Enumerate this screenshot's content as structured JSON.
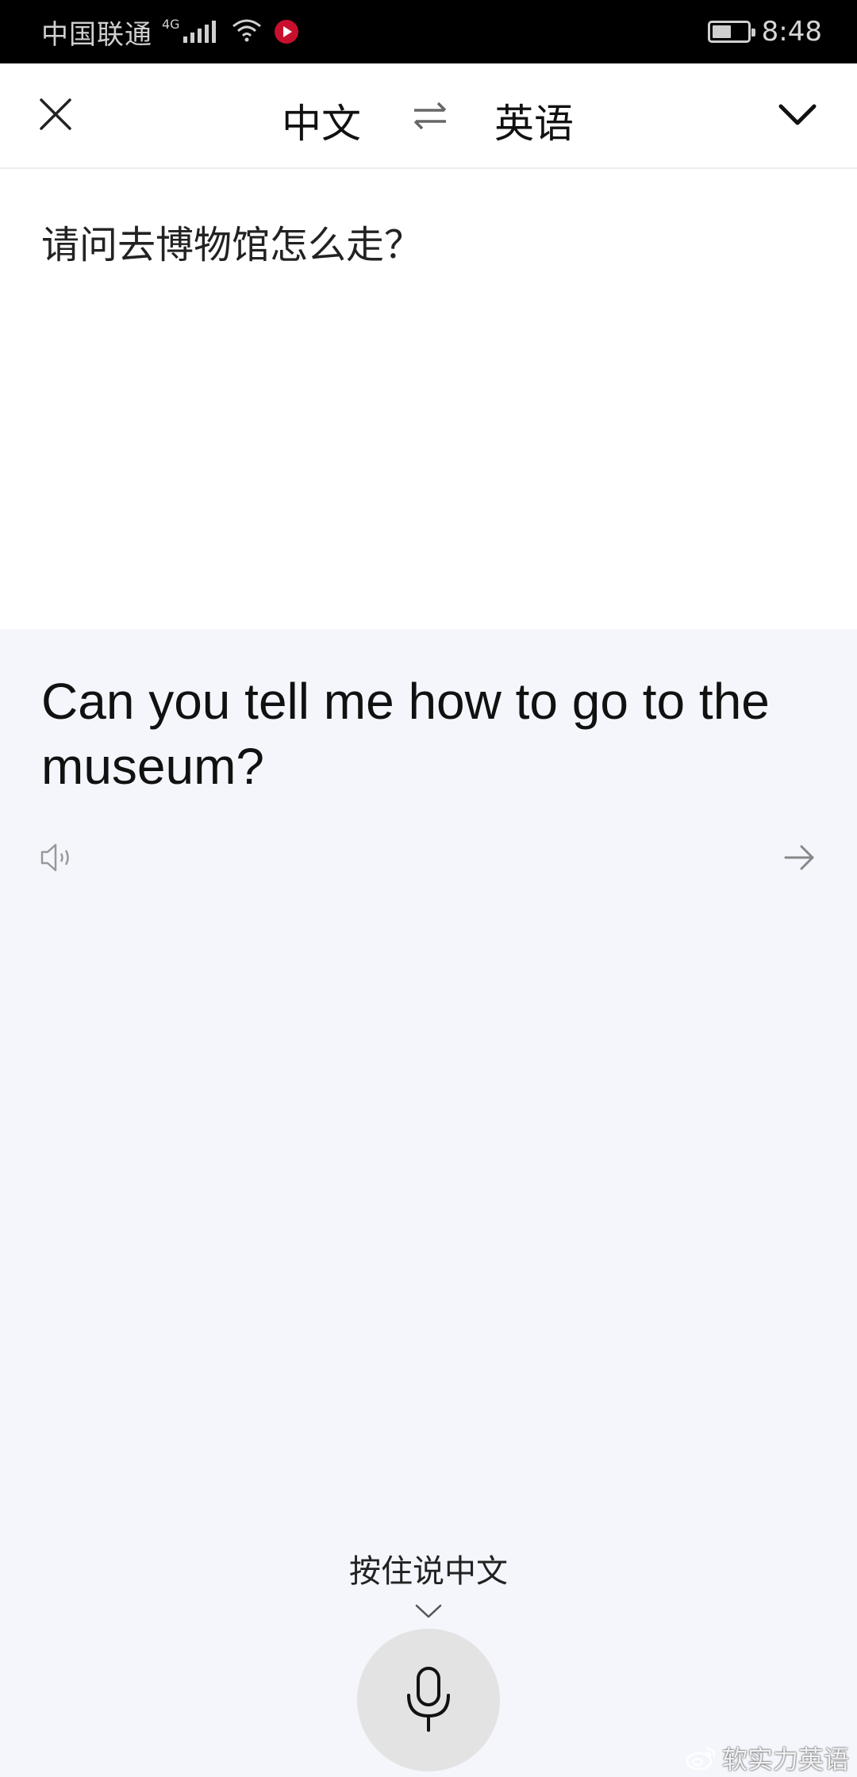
{
  "status_bar": {
    "carrier": "中国联通",
    "network": "4G",
    "time": "8:48",
    "battery_level": 0.55
  },
  "header": {
    "source_lang": "中文",
    "target_lang": "英语"
  },
  "source": {
    "text": "请问去博物馆怎么走？"
  },
  "result": {
    "translation": "Can you tell me how to go to the museum?"
  },
  "voice": {
    "hint": "按住说中文"
  },
  "watermark": {
    "text": "软实力英语"
  },
  "colors": {
    "status_bar_bg": "#000000",
    "result_bg": "#f4f6fc",
    "mic_bg": "#e3e3e3",
    "accent_red": "#c8102e"
  },
  "icons": [
    "close-icon",
    "swap-icon",
    "chevron-down-icon",
    "speaker-icon",
    "arrow-right-icon",
    "microphone-icon",
    "weibo-icon"
  ]
}
